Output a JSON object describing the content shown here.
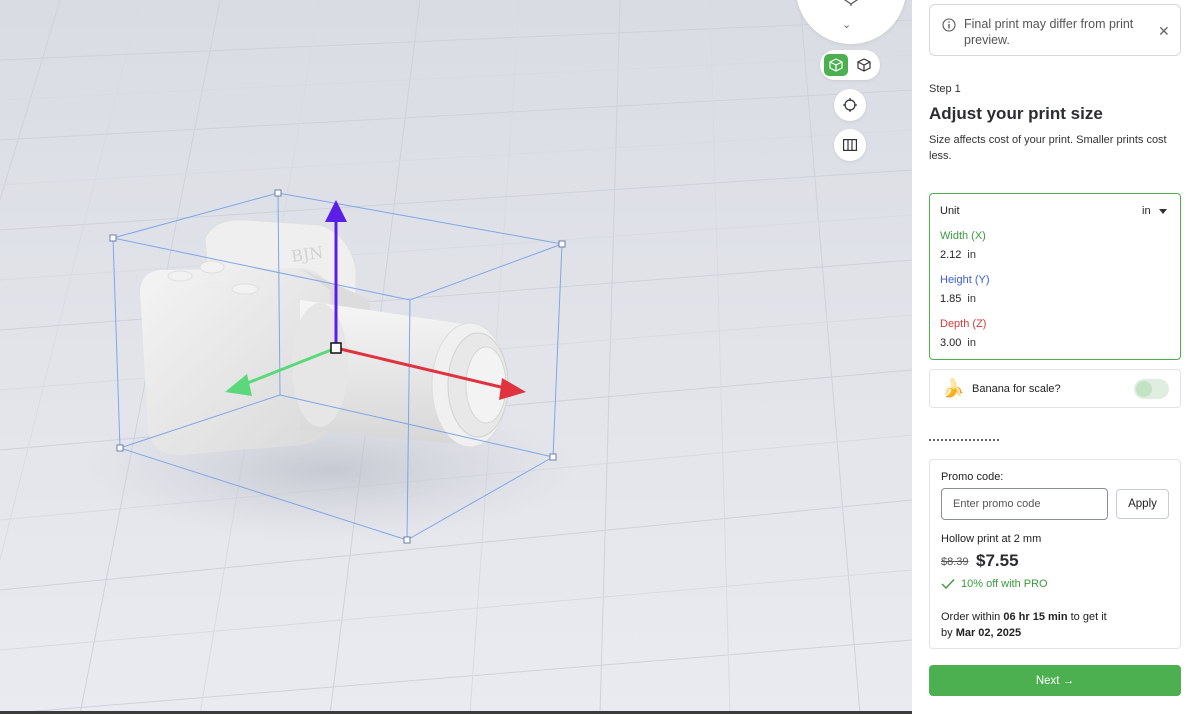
{
  "colors": {
    "accent": "#4caf50",
    "width_label": "#3a9a3f",
    "height_label": "#3b5bdb",
    "depth_label": "#d63a3a",
    "axis_x": "#e0333f",
    "axis_y": "#5a1ee8",
    "axis_z": "#5bd97a"
  },
  "viewport": {
    "model_label": "BJN",
    "icons": [
      "view-cube-icon",
      "solid-view-icon",
      "wireframe-view-icon",
      "center-target-icon",
      "grid-columns-icon"
    ]
  },
  "notice": {
    "text": "Final print may differ from print preview."
  },
  "step": {
    "label": "Step 1",
    "title": "Adjust your print size",
    "description": "Size affects cost of your print. Smaller prints cost less."
  },
  "dimensions": {
    "unit_label": "Unit",
    "unit_value": "in",
    "width_label": "Width (X)",
    "width_value": "2.12",
    "height_label": "Height (Y)",
    "height_value": "1.85",
    "depth_label": "Depth (Z)",
    "depth_value": "3.00",
    "unit_suffix": "in"
  },
  "banana": {
    "label": "Banana for scale?",
    "enabled": false
  },
  "order": {
    "promo_label": "Promo code:",
    "promo_placeholder": "Enter promo code",
    "apply_label": "Apply",
    "hollow_text": "Hollow print at 2 mm",
    "old_price": "$8.39",
    "new_price": "$7.55",
    "pro_text": "10% off with PRO",
    "ship_prefix": "Order within ",
    "ship_time": "06 hr 15 min",
    "ship_middle": " to get it",
    "ship_by": "by ",
    "ship_date": "Mar 02, 2025"
  },
  "next_label": "Next →"
}
